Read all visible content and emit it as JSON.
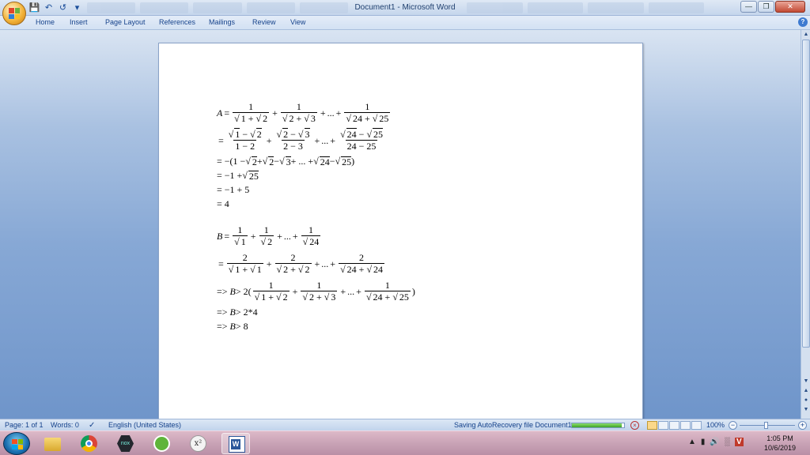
{
  "window": {
    "title": "Document1 - Microsoft Word",
    "controls": [
      "minimize-icon",
      "restore-icon",
      "close-icon"
    ]
  },
  "quick_access": [
    "save-icon",
    "undo-icon",
    "redo-icon",
    "customize-icon"
  ],
  "ribbon": {
    "tabs": [
      "Home",
      "Insert",
      "Page Layout",
      "References",
      "Mailings",
      "Review",
      "View"
    ]
  },
  "math": {
    "a": {
      "var": "A",
      "l1_terms": [
        {
          "num": "1",
          "d1": "1",
          "d2": "2"
        },
        {
          "num": "1",
          "d1": "2",
          "d2": "3"
        },
        {
          "num": "1",
          "d1": "24",
          "d2": "25"
        }
      ],
      "l2_terms": [
        {
          "n1": "1",
          "n2": "2",
          "den": "1 − 2"
        },
        {
          "n1": "2",
          "n2": "3",
          "den": "2 − 3"
        },
        {
          "n1": "24",
          "n2": "25",
          "den": "24 − 25"
        }
      ],
      "l3_parts": [
        "= −(1 − ",
        "2",
        " + ",
        "2",
        " − ",
        "3",
        " + ... + ",
        "24",
        " − ",
        "25",
        ")"
      ],
      "l4_parts": [
        "= −1 + ",
        "25"
      ],
      "l5": "= −1 + 5",
      "l6": "= 4"
    },
    "b": {
      "var": "B",
      "l1_terms": [
        {
          "num": "1",
          "den": "1"
        },
        {
          "num": "1",
          "den": "2"
        },
        {
          "num": "1",
          "den": "24"
        }
      ],
      "l2_terms": [
        {
          "num": "2",
          "d1": "1",
          "d2": "1"
        },
        {
          "num": "2",
          "d1": "2",
          "d2": "2"
        },
        {
          "num": "2",
          "d1": "24",
          "d2": "24"
        }
      ],
      "l3_prefix": "=> ",
      "l3_mid": " > 2(",
      "l3_terms": [
        {
          "num": "1",
          "d1": "1",
          "d2": "2"
        },
        {
          "num": "1",
          "d1": "2",
          "d2": "3"
        },
        {
          "num": "1",
          "d1": "24",
          "d2": "25"
        }
      ],
      "l3_suffix": ")",
      "l4_prefix": "=> ",
      "l4_rest": " > 2*4",
      "l5_prefix": "=> ",
      "l5_rest": " > 8"
    },
    "ops": {
      "eq": "=",
      "plus": "+",
      "minus": "−",
      "ellipsis": "..."
    }
  },
  "status_bar": {
    "page": "Page: 1 of 1",
    "words": "Words: 0",
    "language": "English (United States)",
    "autosave": "Saving AutoRecovery file Document1:",
    "autosave_progress": 0.95,
    "zoom": "100%"
  },
  "taskbar": {
    "apps": [
      "explorer-icon",
      "chrome-icon",
      "nox-icon",
      "green-app-icon",
      "math-app-icon",
      "word-icon"
    ],
    "time": "1:05 PM",
    "date": "10/6/2019"
  },
  "colors": {
    "accent": "#15428b",
    "workspace_top": "#d9e4f2",
    "workspace_bottom": "#6f95ca",
    "taskbar": "#c9a3b6"
  }
}
